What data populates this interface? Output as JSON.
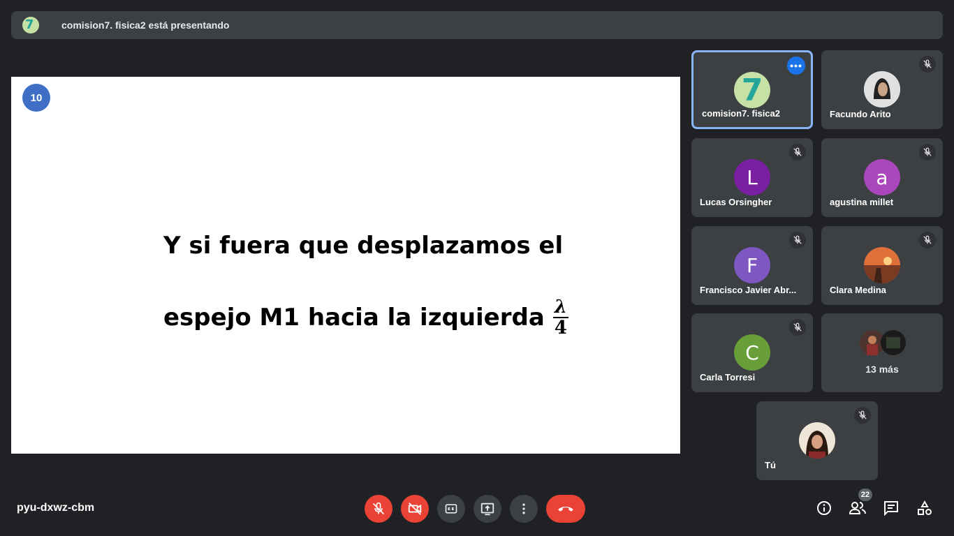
{
  "banner": {
    "avatar_glyph": "7",
    "text": "comision7. fisica2 está presentando"
  },
  "slide": {
    "number": "10",
    "line1": "Y si fuera que desplazamos el",
    "line2": "espejo M1 hacia la izquierda",
    "frac_num": "λ",
    "frac_den": "4"
  },
  "participants": [
    {
      "name": "comision7. fisica2",
      "avatar_glyph": "7",
      "color": "#c5e1a5"
    },
    {
      "name": "Facundo Arito"
    },
    {
      "name": "Lucas Orsingher",
      "initial": "L",
      "color": "#7b1fa2"
    },
    {
      "name": "agustina millet",
      "initial": "a",
      "color": "#ab47bc"
    },
    {
      "name": "Francisco Javier Abr...",
      "initial": "F",
      "color": "#7e57c2"
    },
    {
      "name": "Clara Medina"
    },
    {
      "name": "Carla Torresi",
      "initial": "C",
      "color": "#689f38"
    },
    {
      "more_label": "13 más"
    },
    {
      "name": "Tú"
    }
  ],
  "meeting_code": "pyu-dxwz-cbm",
  "people_count": "22",
  "colors": {
    "end_call": "#ea4335",
    "active_border": "#8ab4f8",
    "accent": "#1a73e8"
  }
}
